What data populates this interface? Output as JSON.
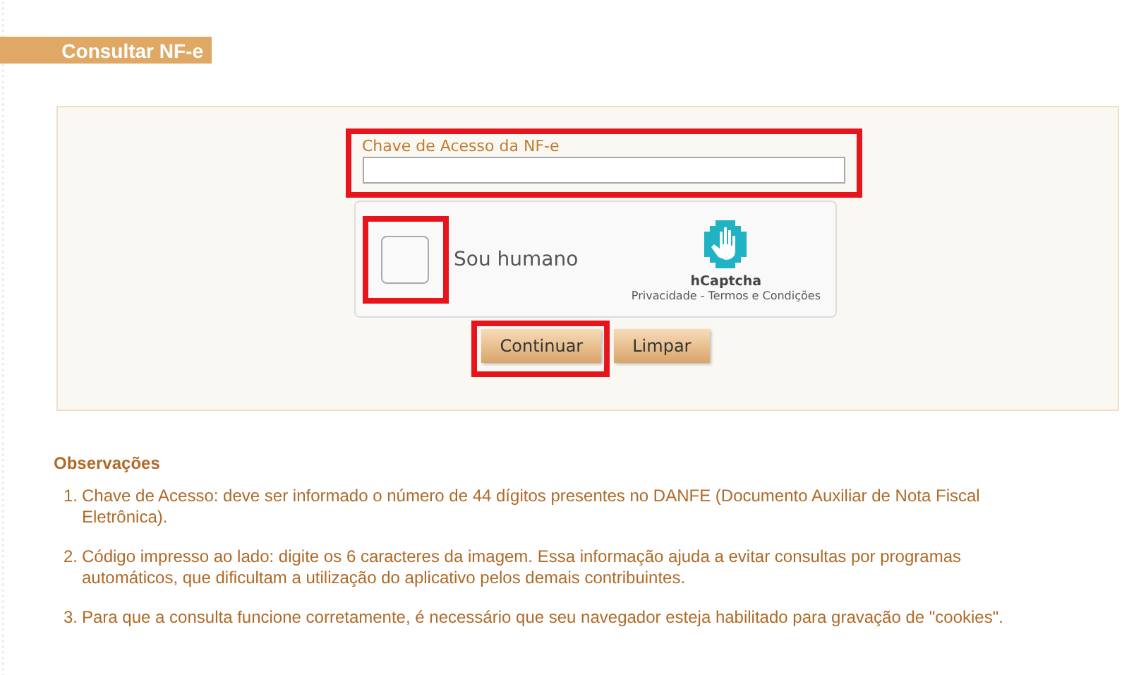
{
  "page_title": "Consultar NF-e",
  "access_key": {
    "label": "Chave de Acesso da NF-e",
    "highlighted": true
  },
  "captcha": {
    "label": "Sou humano",
    "checked": false,
    "highlighted": true,
    "brand": "hCaptcha",
    "links": [
      "Privacidade - Termos e Condições"
    ]
  },
  "buttons": [
    {
      "label": "Continuar",
      "highlighted": true
    },
    {
      "label": "Limpar",
      "highlighted": false
    }
  ],
  "notes": {
    "title": "Observações",
    "items": [
      {
        "number": "1.",
        "text": "Chave de Acesso: deve ser informado o número de 44 dígitos presentes no DANFE (Documento Auxiliar de Nota Fiscal Eletrônica)."
      },
      {
        "number": "2.",
        "text": "Código impresso ao lado: digite os 6 caracteres da imagem. Essa informação ajuda a evitar consultas por programas automáticos, que dificultam a utilização do aplicativo pelos demais contribuintes."
      },
      {
        "number": "3.",
        "text": "Para que a consulta funcione corretamente, é necessário que seu navegador esteja habilitado para gravação de \"cookies\"."
      }
    ]
  }
}
